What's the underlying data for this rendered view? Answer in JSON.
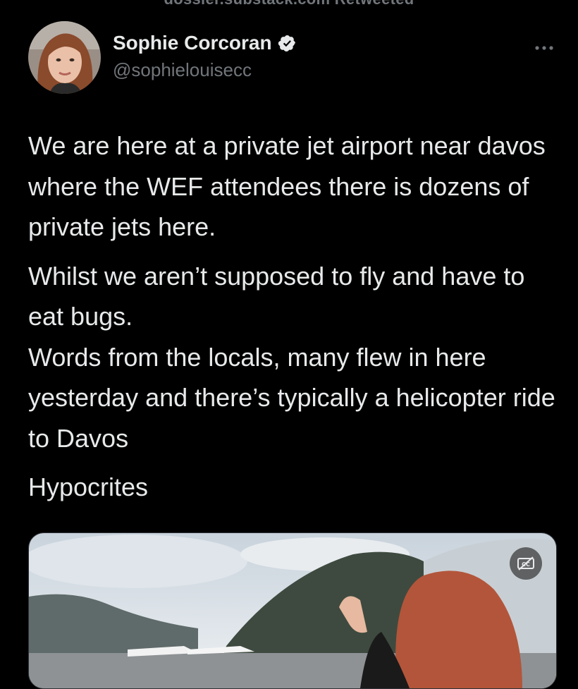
{
  "retweet": {
    "text": "dossier.substack.com Retweeted"
  },
  "tweet": {
    "author": {
      "name": "Sophie Corcoran",
      "handle": "@sophielouisecc",
      "verified": true
    },
    "more_icon": "more-horizontal-icon",
    "paragraphs": [
      [
        "We are here at a private jet airport near davos where the WEF attendees there is dozens of private jets here."
      ],
      [
        "Whilst we aren’t supposed to fly and have to eat bugs.",
        "Words from the locals, many flew in here yesterday and there’s typically a helicopter ride to Davos"
      ],
      [
        "Hypocrites"
      ]
    ],
    "media": {
      "type": "video",
      "cc_icon": "closed-captions-off-icon"
    }
  },
  "colors": {
    "background": "#000000",
    "text": "#e7e9ea",
    "secondary": "#71767b",
    "verified": "#e7e9ea"
  }
}
